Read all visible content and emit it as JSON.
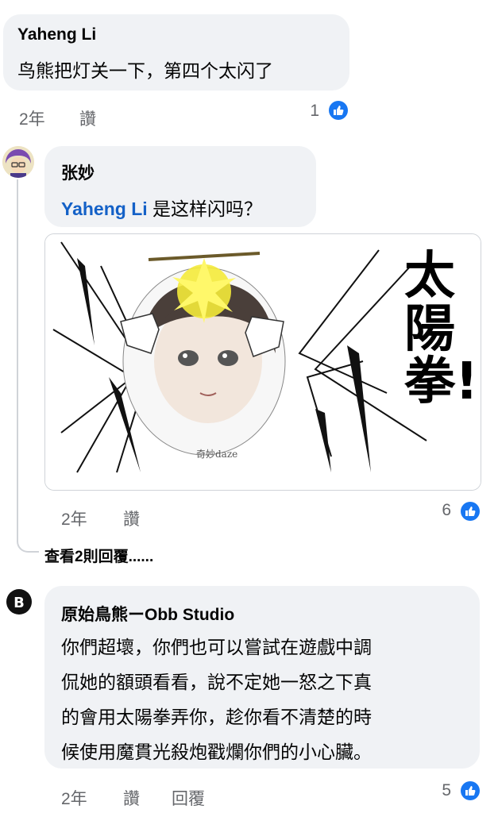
{
  "comments": [
    {
      "author": "Yaheng Li",
      "text": "鸟熊把灯关一下，第四个太闪了",
      "time": "2年",
      "like_label": "讚",
      "reactions": "1"
    },
    {
      "author": "张妙",
      "mention": "Yaheng Li",
      "text": " 是这样闪吗？",
      "image": {
        "side_text": "太陽拳!!",
        "watermark": "奇妙daze"
      },
      "time": "2年",
      "like_label": "讚",
      "reactions": "6"
    },
    {
      "author": "原始鳥熊ーObb Studio",
      "lines": [
        "你們超壞，你們也可以嘗試在遊戲中調",
        "侃她的額頭看看，說不定她一怒之下真",
        "的會用太陽拳弄你，趁你看不清楚的時",
        "候使用魔貫光殺炮戳爛你們的小心臟。"
      ],
      "time": "2年",
      "like_label": "讚",
      "reply_label": "回覆",
      "reactions": "5"
    }
  ],
  "view_replies": "查看2則回覆......",
  "colors": {
    "accent": "#1877f2",
    "mention": "#1461c7",
    "bubble": "#f0f2f5",
    "meta": "#65676b"
  }
}
